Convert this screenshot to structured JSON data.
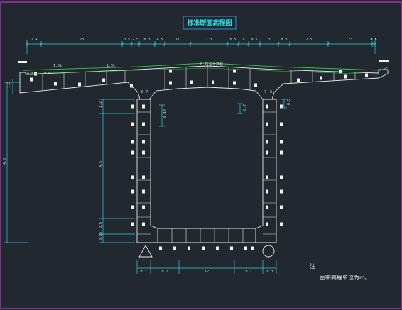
{
  "colors": {
    "background": "#212830",
    "frame": "#c238c8",
    "outline": "#e8e8e8",
    "deck_line": "#36c24a",
    "dimension": "#2fd0d8",
    "title_box": "#2d8fd0",
    "title_text": "#29e0e8",
    "text": "#d8d8d8"
  },
  "title": "标准断面高程图",
  "top_dimensions": [
    "1.4",
    "23",
    "0.5",
    "2.5",
    "0.3",
    "4.5",
    "11",
    "1.3",
    "0.5",
    "9",
    "0.5",
    "3",
    "0.3",
    "2.5",
    "23",
    "0.5",
    "1.4"
  ],
  "deck_labels": {
    "slope_left": "1.5%",
    "centerline": "0.1(设计高程)",
    "slope_right": "1.5%",
    "left_thickness": "0.3",
    "overhang": "0.5",
    "web_marks": [
      "8",
      "7",
      "7",
      "8"
    ]
  },
  "left_dimensions": [
    "1.2",
    "4.5",
    "0.6",
    "0.35",
    "0.3"
  ],
  "total_height": "4.8",
  "inner_dimensions": [
    "0.14",
    "0.7",
    "0.5"
  ],
  "bottom_dimensions": [
    "0.3",
    "0.7",
    "12",
    "0.7",
    "0.3"
  ],
  "note": {
    "heading": "注",
    "text": "图中高程单位为m。"
  }
}
